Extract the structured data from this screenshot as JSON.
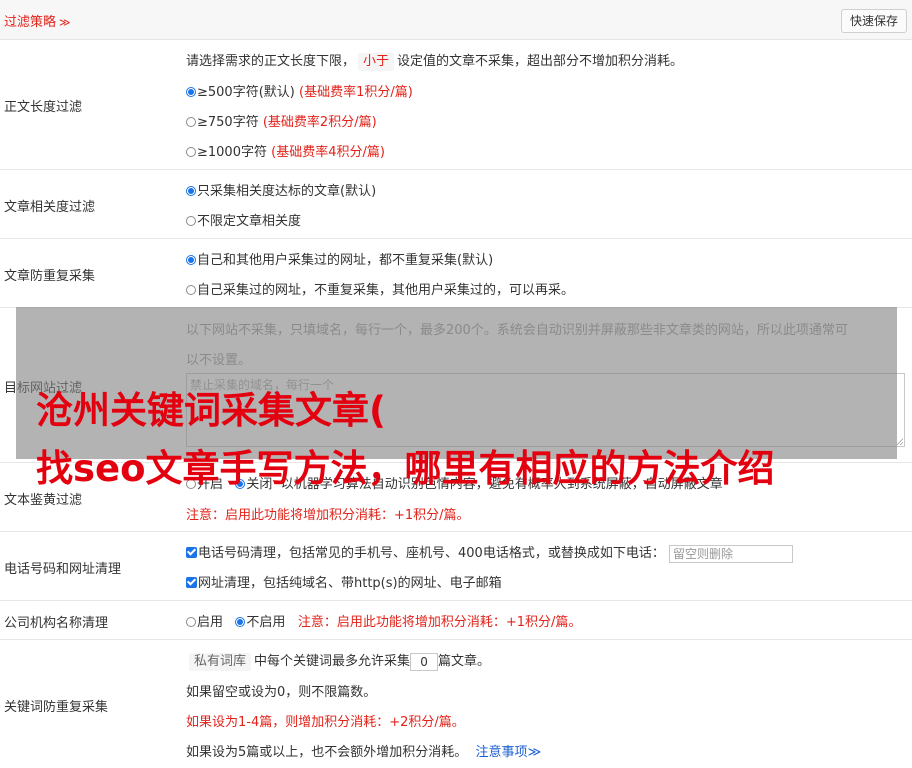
{
  "header": {
    "title": "过滤策略",
    "chevron": "≫",
    "save_button": "快速保存"
  },
  "body_length": {
    "label": "正文长度过滤",
    "desc_pre": "请选择需求的正文长度下限，",
    "desc_tag": "小于",
    "desc_post": "设定值的文章不采集，超出部分不增加积分消耗。",
    "options": [
      {
        "text": "≥500字符(默认)",
        "note": "(基础费率1积分/篇)",
        "selected": true
      },
      {
        "text": "≥750字符",
        "note": "(基础费率2积分/篇)",
        "selected": false
      },
      {
        "text": "≥1000字符",
        "note": "(基础费率4积分/篇)",
        "selected": false
      }
    ]
  },
  "relevance": {
    "label": "文章相关度过滤",
    "options": [
      {
        "text": "只采集相关度达标的文章(默认)",
        "selected": true
      },
      {
        "text": "不限定文章相关度",
        "selected": false
      }
    ]
  },
  "duplicate": {
    "label": "文章防重复采集",
    "options": [
      {
        "text": "自己和其他用户采集过的网址，都不重复采集(默认)",
        "selected": true
      },
      {
        "text": "自己采集过的网址，不重复采集，其他用户采集过的，可以再采。",
        "selected": false
      }
    ]
  },
  "site_filter": {
    "label": "目标网站过滤",
    "desc_line1": "以下网站不采集，只填域名，每行一个，最多200个。系统会自动识别并屏蔽那些非文章类的网站，所以此项通常可",
    "desc_line2": "以不设置。",
    "placeholder": "禁止采集的域名，每行一个"
  },
  "porn_filter": {
    "label": "文本鉴黄过滤",
    "option_on": "开启",
    "option_off": "关闭",
    "desc": "以机器学习算法自动识别色情内容，避免有概率大到系统屏蔽，自动屏蔽文章",
    "note": "注意：启用此功能将增加积分消耗：+1积分/篇。"
  },
  "phone_url": {
    "label": "电话号码和网址清理",
    "phone_text": "电话号码清理，包括常见的手机号、座机号、400电话格式，或替换成如下电话：",
    "phone_placeholder": "留空则删除",
    "url_text": "网址清理，包括纯域名、带http(s)的网址、电子邮箱"
  },
  "company": {
    "label": "公司机构名称清理",
    "option_on": "启用",
    "option_off": "不启用",
    "note": "注意：启用此功能将增加积分消耗：+1积分/篇。"
  },
  "keyword_dup": {
    "label": "关键词防重复采集",
    "tag": "私有词库",
    "line1_pre": "中每个关键词最多允许采集",
    "count": "0",
    "line1_post": "篇文章。",
    "line2": "如果留空或设为0，则不限篇数。",
    "line3": "如果设为1-4篇，则增加积分消耗：+2积分/篇。",
    "line4": "如果设为5篇或以上，也不会额外增加积分消耗。",
    "link": "注意事项",
    "link_icon": "≫"
  },
  "overlay_text": {
    "line1": "沧州关键词采集文章(",
    "line2": "找seo文章手写方法，哪里有相应的方法介绍"
  }
}
